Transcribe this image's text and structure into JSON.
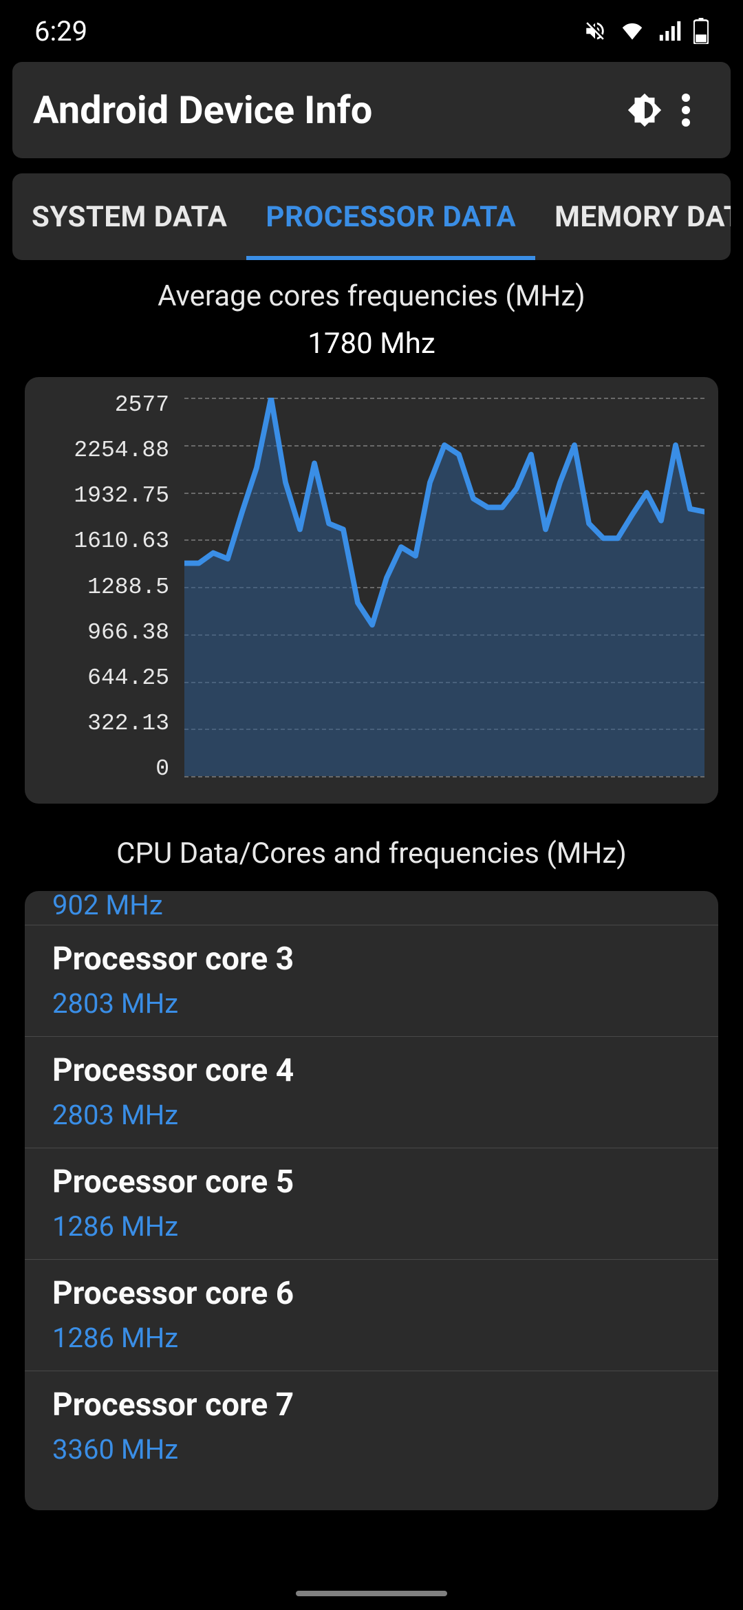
{
  "status": {
    "time": "6:29"
  },
  "header": {
    "title": "Android Device Info"
  },
  "tabs": [
    {
      "label": "SYSTEM DATA",
      "active": false
    },
    {
      "label": "PROCESSOR DATA",
      "active": true
    },
    {
      "label": "MEMORY DATA",
      "active": false
    }
  ],
  "avg_section": {
    "title": "Average cores frequencies (MHz)",
    "value": "1780 Mhz"
  },
  "chart_title_2": "CPU Data/Cores and frequencies (MHz)",
  "chart_data": {
    "type": "area",
    "ylabel": "",
    "xlabel": "",
    "ylim": [
      0,
      2577
    ],
    "y_ticks": [
      "2577",
      "2254.88",
      "1932.75",
      "1610.63",
      "1288.5",
      "966.38",
      "644.25",
      "322.13",
      "0"
    ],
    "values": [
      1450,
      1450,
      1520,
      1480,
      1800,
      2100,
      2577,
      2000,
      1680,
      2130,
      1720,
      1680,
      1180,
      1030,
      1350,
      1560,
      1500,
      2000,
      2254,
      2190,
      1890,
      1830,
      1830,
      1960,
      2190,
      1680,
      2000,
      2254,
      1720,
      1620,
      1620,
      1780,
      1930,
      1740,
      2254,
      1820,
      1800
    ]
  },
  "cores": {
    "partial_freq": "902 MHz",
    "items": [
      {
        "name": "Processor core 3",
        "freq": "2803 MHz"
      },
      {
        "name": "Processor core 4",
        "freq": "2803 MHz"
      },
      {
        "name": "Processor core 5",
        "freq": "1286 MHz"
      },
      {
        "name": "Processor core 6",
        "freq": "1286 MHz"
      },
      {
        "name": "Processor core 7",
        "freq": "3360 MHz"
      }
    ]
  }
}
